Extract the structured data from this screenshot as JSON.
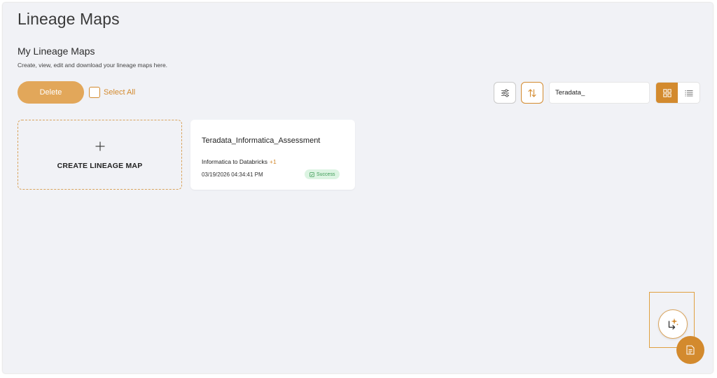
{
  "page": {
    "title": "Lineage Maps",
    "section_title": "My Lineage Maps",
    "section_subtitle": "Create, view, edit and download your lineage maps here."
  },
  "toolbar": {
    "delete_label": "Delete",
    "select_all_label": "Select All",
    "filter_icon": "sliders-icon",
    "sort_icon": "sort-arrows-icon",
    "search_value": "Teradata_",
    "view_mode": "grid"
  },
  "create_card": {
    "label": "CREATE LINEAGE MAP"
  },
  "maps": [
    {
      "title": "Teradata_Informatica_Assessment",
      "conversion": "Informatica to Databricks",
      "more": "+1",
      "date": "03/19/2026 04:34:41 PM",
      "status": "Success"
    }
  ],
  "colors": {
    "accent": "#d38a2e",
    "accent_light": "#e2a75a",
    "success_bg": "#dcf4e2",
    "success_text": "#3c9a55",
    "background": "#f1f2f6"
  }
}
